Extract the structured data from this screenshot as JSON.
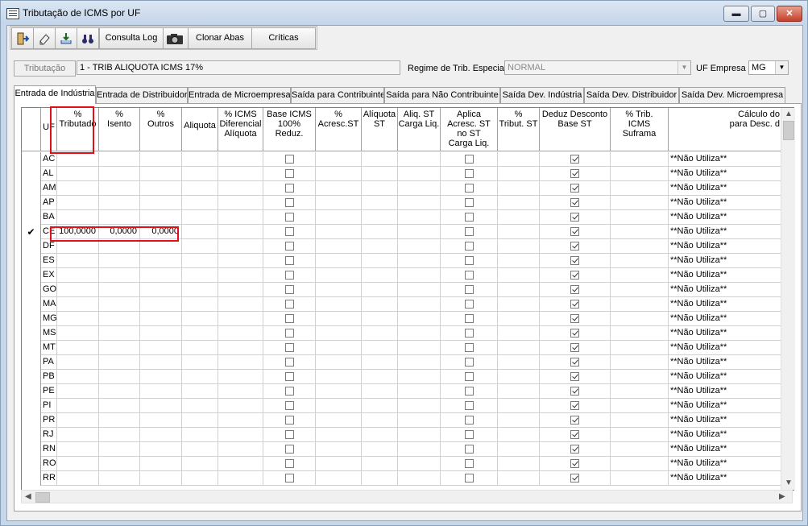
{
  "window": {
    "title": "Tributação de ICMS por UF",
    "min": "▬",
    "max": "▢",
    "close": "✕"
  },
  "toolbar": {
    "consulta_log": "Consulta Log",
    "clonar_abas": "Clonar Abas",
    "criticas": "Críticas"
  },
  "filter": {
    "tributacao_button": "Tributação",
    "tributacao_value": "1  -  TRIB ALIQUOTA ICMS 17%",
    "regime_label": "Regime de Trib. Especial",
    "regime_value": "NORMAL",
    "uf_label": "UF Empresa",
    "uf_value": "MG"
  },
  "tabs": [
    "Entrada de Indústria",
    "Entrada de Distribuidor",
    "Entrada de Microempresa",
    "Saída para Contribuinte",
    "Saída para Não Contribuinte",
    "Saída Dev. Indústria",
    "Saída Dev. Distribuidor",
    "Saída Dev. Microempresa"
  ],
  "columns": {
    "uf": "UF",
    "tributado": "%\nTributado",
    "isento": "%\nIsento",
    "outros": "%\nOutros",
    "aliquota": "Aliquota",
    "icms_dif": "% ICMS\nDiferencial\nAlíquota",
    "base_icms": "Base ICMS\n100% Reduz.",
    "acresc_st": "%\nAcresc.ST",
    "aliquota_st": "Alíquota\nST",
    "aliq_st_carga": "Aliq. ST\nCarga Liq.",
    "aplica_acresc": "Aplica\nAcresc. ST\nno ST\nCarga Liq.",
    "tribut_st": "%\nTribut. ST",
    "deduz_desconto": "Deduz Desconto\nBase ST",
    "trib_suframa": "% Trib.\nICMS Suframa",
    "calculo": "Cálculo do\npara Desc. d"
  },
  "row_marker": "✔",
  "calculo_value": "**Não Utiliza**",
  "rows": [
    {
      "uf": "AC",
      "tributado": "",
      "isento": "",
      "outros": "",
      "base": false,
      "aplica": false,
      "deduz": true
    },
    {
      "uf": "AL",
      "tributado": "",
      "isento": "",
      "outros": "",
      "base": false,
      "aplica": false,
      "deduz": true
    },
    {
      "uf": "AM",
      "tributado": "",
      "isento": "",
      "outros": "",
      "base": false,
      "aplica": false,
      "deduz": true
    },
    {
      "uf": "AP",
      "tributado": "",
      "isento": "",
      "outros": "",
      "base": false,
      "aplica": false,
      "deduz": true
    },
    {
      "uf": "BA",
      "tributado": "",
      "isento": "",
      "outros": "",
      "base": false,
      "aplica": false,
      "deduz": true
    },
    {
      "uf": "CE",
      "tributado": "100,0000",
      "isento": "0,0000",
      "outros": "0,0000",
      "base": false,
      "aplica": false,
      "deduz": true,
      "current": true
    },
    {
      "uf": "DF",
      "tributado": "",
      "isento": "",
      "outros": "",
      "base": false,
      "aplica": false,
      "deduz": true
    },
    {
      "uf": "ES",
      "tributado": "",
      "isento": "",
      "outros": "",
      "base": false,
      "aplica": false,
      "deduz": true
    },
    {
      "uf": "EX",
      "tributado": "",
      "isento": "",
      "outros": "",
      "base": false,
      "aplica": false,
      "deduz": true
    },
    {
      "uf": "GO",
      "tributado": "",
      "isento": "",
      "outros": "",
      "base": false,
      "aplica": false,
      "deduz": true
    },
    {
      "uf": "MA",
      "tributado": "",
      "isento": "",
      "outros": "",
      "base": false,
      "aplica": false,
      "deduz": true
    },
    {
      "uf": "MG",
      "tributado": "",
      "isento": "",
      "outros": "",
      "base": false,
      "aplica": false,
      "deduz": true
    },
    {
      "uf": "MS",
      "tributado": "",
      "isento": "",
      "outros": "",
      "base": false,
      "aplica": false,
      "deduz": true
    },
    {
      "uf": "MT",
      "tributado": "",
      "isento": "",
      "outros": "",
      "base": false,
      "aplica": false,
      "deduz": true
    },
    {
      "uf": "PA",
      "tributado": "",
      "isento": "",
      "outros": "",
      "base": false,
      "aplica": false,
      "deduz": true
    },
    {
      "uf": "PB",
      "tributado": "",
      "isento": "",
      "outros": "",
      "base": false,
      "aplica": false,
      "deduz": true
    },
    {
      "uf": "PE",
      "tributado": "",
      "isento": "",
      "outros": "",
      "base": false,
      "aplica": false,
      "deduz": true
    },
    {
      "uf": "PI",
      "tributado": "",
      "isento": "",
      "outros": "",
      "base": false,
      "aplica": false,
      "deduz": true
    },
    {
      "uf": "PR",
      "tributado": "",
      "isento": "",
      "outros": "",
      "base": false,
      "aplica": false,
      "deduz": true
    },
    {
      "uf": "RJ",
      "tributado": "",
      "isento": "",
      "outros": "",
      "base": false,
      "aplica": false,
      "deduz": true
    },
    {
      "uf": "RN",
      "tributado": "",
      "isento": "",
      "outros": "",
      "base": false,
      "aplica": false,
      "deduz": true
    },
    {
      "uf": "RO",
      "tributado": "",
      "isento": "",
      "outros": "",
      "base": false,
      "aplica": false,
      "deduz": true
    },
    {
      "uf": "RR",
      "tributado": "",
      "isento": "",
      "outros": "",
      "base": false,
      "aplica": false,
      "deduz": true
    }
  ]
}
